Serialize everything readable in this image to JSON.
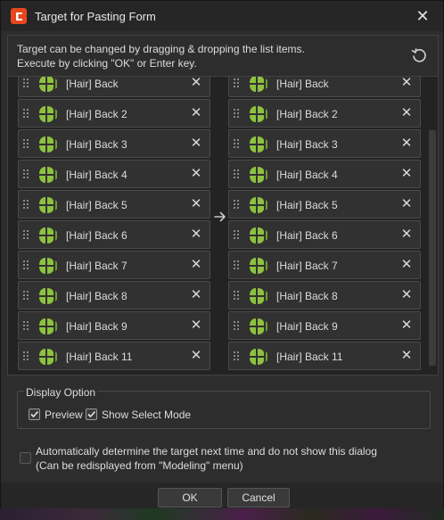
{
  "window": {
    "title": "Target for Pasting Form"
  },
  "info": {
    "line1": "Target can be changed by dragging & dropping the list items.",
    "line2": "Execute by clicking \"OK\" or Enter key."
  },
  "left_list": [
    {
      "label": "[Hair] Back"
    },
    {
      "label": "[Hair] Back 2"
    },
    {
      "label": "[Hair] Back 3"
    },
    {
      "label": "[Hair] Back 4"
    },
    {
      "label": "[Hair] Back 5"
    },
    {
      "label": "[Hair] Back 6"
    },
    {
      "label": "[Hair] Back 7"
    },
    {
      "label": "[Hair] Back 8"
    },
    {
      "label": "[Hair] Back 9"
    },
    {
      "label": "[Hair] Back 11"
    }
  ],
  "right_list": [
    {
      "label": "[Hair] Back"
    },
    {
      "label": "[Hair] Back 2"
    },
    {
      "label": "[Hair] Back 3"
    },
    {
      "label": "[Hair] Back 4"
    },
    {
      "label": "[Hair] Back 5"
    },
    {
      "label": "[Hair] Back 6"
    },
    {
      "label": "[Hair] Back 7"
    },
    {
      "label": "[Hair] Back 8"
    },
    {
      "label": "[Hair] Back 9"
    },
    {
      "label": "[Hair] Back 11"
    }
  ],
  "item_icon": "hair-layer-icon",
  "remove_glyph": "✕",
  "display_option": {
    "legend": "Display Option",
    "preview": {
      "label": "Preview",
      "checked": true
    },
    "show_select_mode": {
      "label": "Show Select Mode",
      "checked": true
    }
  },
  "auto_determine": {
    "line1": "Automatically determine the target next time and do not show this dialog",
    "line2": "(Can be redisplayed from \"Modeling\" menu)",
    "checked": false
  },
  "buttons": {
    "ok": "OK",
    "cancel": "Cancel"
  },
  "colors": {
    "accent": "#e8461f",
    "icon_green": "#8dc13f",
    "dialog_bg": "#2d2d2d"
  }
}
